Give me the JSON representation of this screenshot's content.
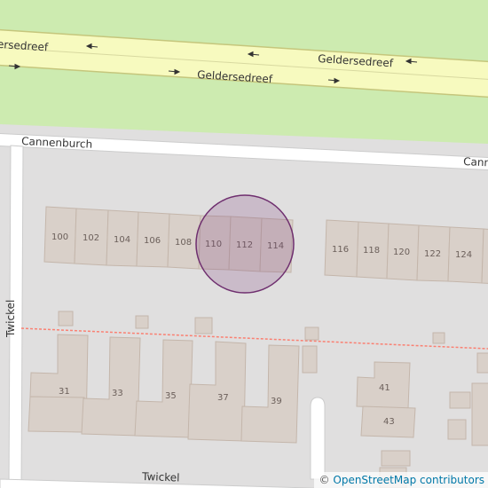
{
  "map": {
    "colors": {
      "grass": "#cdebb0",
      "residential": "#e0dfdf",
      "building": "#d9d0c9",
      "building_edge": "#c4b6ab",
      "primary_road": "#f7fabf",
      "primary_casing": "#c5c67c",
      "street": "#ffffff",
      "street_casing": "#cccccc",
      "footpath": "#fa8072",
      "marker_fill": "#7a3a7a",
      "marker_stroke": "#6f2f6f"
    },
    "roads": {
      "geldersedreef_1": "Geldersedreef",
      "geldersedreef_2": "Geldersedreef",
      "geldersedreef_3": "Geldersedreef",
      "cannenburch_1": "Cannenburch",
      "cannenburch_2": "Cannenburch",
      "twickel_1": "Twickel",
      "twickel_2": "Twickel"
    },
    "house_numbers": [
      "100",
      "102",
      "104",
      "106",
      "108",
      "110",
      "112",
      "114",
      "116",
      "118",
      "120",
      "122",
      "124",
      "31",
      "33",
      "35",
      "37",
      "39",
      "41",
      "43"
    ],
    "marker": {
      "shape": "circle",
      "highlighted_numbers": [
        "110",
        "112",
        "114"
      ]
    }
  },
  "attribution": {
    "copyright": "©",
    "link": "OpenStreetMap contributors"
  }
}
